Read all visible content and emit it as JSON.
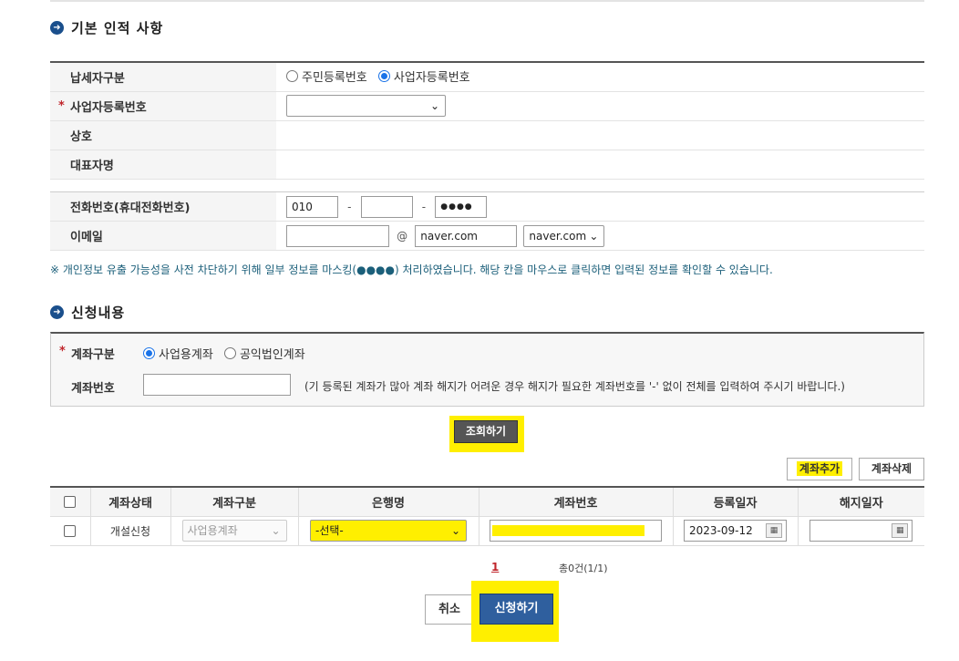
{
  "basic_section": {
    "title": "기본 인적 사항",
    "taxpayer_type": {
      "label": "납세자구분",
      "options": [
        "주민등록번호",
        "사업자등록번호"
      ],
      "selected": "사업자등록번호"
    },
    "business_number": {
      "label": "사업자등록번호",
      "value": ""
    },
    "company_name": {
      "label": "상호",
      "value": ""
    },
    "representative": {
      "label": "대표자명",
      "value": ""
    },
    "phone": {
      "label": "전화번호(휴대전화번호)",
      "part1": "010",
      "part2": "",
      "part3": "●●●●",
      "separator": "-"
    },
    "email": {
      "label": "이메일",
      "local": "",
      "at": "@",
      "domain": "naver.com",
      "domain_select": "naver.com"
    },
    "notice": "※ 개인정보 유출 가능성을 사전 차단하기 위해 일부 정보를 마스킹(●●●●) 처리하였습니다. 해당 칸을 마우스로 클릭하면 입력된 정보를 확인할 수 있습니다."
  },
  "request_section": {
    "title": "신청내용",
    "account_type": {
      "label": "계좌구분",
      "options": [
        "사업용계좌",
        "공익법인계좌"
      ],
      "selected": "사업용계좌"
    },
    "account_number": {
      "label": "계좌번호",
      "value": "",
      "note": "(기 등록된 계좌가 많아 계좌 해지가 어려운 경우 해지가 필요한 계좌번호를 '-' 없이 전체를 입력하여 주시기 바랍니다.)"
    },
    "search_button": "조회하기",
    "add_account_button": "계좌추가",
    "delete_account_button": "계좌삭제"
  },
  "grid": {
    "headers": [
      "계좌상태",
      "계좌구분",
      "은행명",
      "계좌번호",
      "등록일자",
      "해지일자"
    ],
    "rows": [
      {
        "status": "개설신청",
        "account_type": "사업용계좌",
        "bank": "-선택-",
        "account_number": "",
        "reg_date": "2023-09-12",
        "close_date": ""
      }
    ]
  },
  "pagination": {
    "current_page": "1",
    "summary": "총0건(1/1)"
  },
  "footer": {
    "cancel_button": "취소",
    "submit_button": "신청하기"
  },
  "colors": {
    "highlight": "#ffef00",
    "primary": "#2f5f9e",
    "required": "#c0262c",
    "notice_text": "#1b5f7a"
  }
}
